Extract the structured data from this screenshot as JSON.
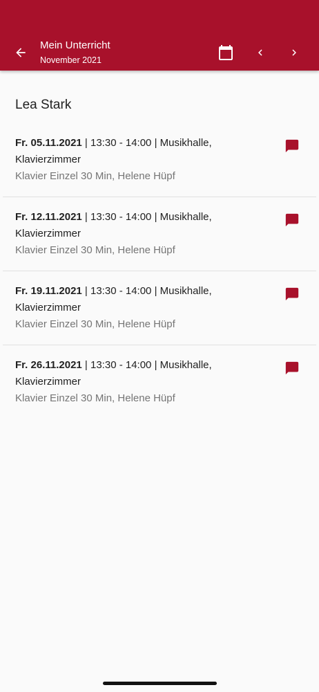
{
  "header": {
    "title": "Mein Unterricht",
    "subtitle": "November 2021",
    "back_icon": "arrow-left-icon",
    "calendar_icon": "calendar-icon",
    "prev_icon": "chevron-left-icon",
    "next_icon": "chevron-right-icon",
    "background_color": "#a8112b"
  },
  "student": {
    "name": "Lea Stark"
  },
  "lessons": [
    {
      "date": "Fr. 05.11.2021",
      "details": " | 13:30 - 14:00 | Musikhalle, Klavierzimmer",
      "subtitle": "Klavier Einzel 30 Min, Helene Hüpf",
      "icon": "message-icon"
    },
    {
      "date": "Fr. 12.11.2021",
      "details": " | 13:30 - 14:00 | Musikhalle, Klavierzimmer",
      "subtitle": "Klavier Einzel 30 Min, Helene Hüpf",
      "icon": "message-icon"
    },
    {
      "date": "Fr. 19.11.2021",
      "details": " | 13:30 - 14:00 | Musikhalle, Klavierzimmer",
      "subtitle": "Klavier Einzel 30 Min, Helene Hüpf",
      "icon": "message-icon"
    },
    {
      "date": "Fr. 26.11.2021",
      "details": " | 13:30 - 14:00 | Musikhalle, Klavierzimmer",
      "subtitle": "Klavier Einzel 30 Min, Helene Hüpf",
      "icon": "message-icon"
    }
  ],
  "accent_color": "#a8112b"
}
